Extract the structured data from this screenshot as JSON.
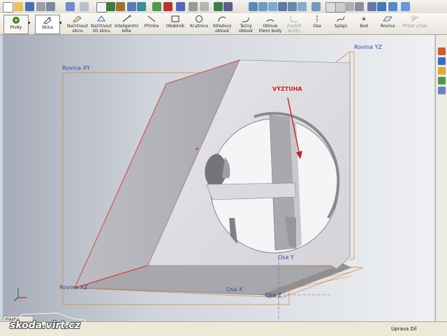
{
  "toolbar_top": {
    "icons": [
      "new-icon",
      "open-icon",
      "save-icon",
      "print-icon",
      "undo-icon",
      "redo-icon",
      "select-icon",
      "rebuild-icon",
      "options-icon",
      "zoom-fit-icon",
      "zoom-area-icon",
      "zoom-icon",
      "rotate-icon",
      "pan-icon",
      "view-orientation-icon",
      "display-style-icon",
      "section-view-icon",
      "appearance-icon",
      "scene-icon"
    ]
  },
  "command_manager": {
    "tabs": [
      {
        "label": "Prvky"
      },
      {
        "label": "Skica"
      }
    ],
    "commands": [
      {
        "label1": "Načrtnout",
        "label2": "skicu"
      },
      {
        "label1": "Načrtnout",
        "label2": "3D skicu"
      },
      {
        "label1": "Inteligentní",
        "label2": "kóta"
      },
      {
        "label1": "Přímka",
        "label2": ""
      },
      {
        "label1": "Obdélník",
        "label2": ""
      },
      {
        "label1": "Kružnice",
        "label2": ""
      },
      {
        "label1": "Středový",
        "label2": "oblouk"
      },
      {
        "label1": "Tečný",
        "label2": "oblouk"
      },
      {
        "label1": "Oblouk",
        "label2": "třemi body"
      },
      {
        "label1": "Zaoblit",
        "label2": "entity"
      },
      {
        "label1": "Osa",
        "label2": ""
      },
      {
        "label1": "Splajn",
        "label2": ""
      },
      {
        "label1": "Bod",
        "label2": ""
      },
      {
        "label1": "Rovina",
        "label2": ""
      },
      {
        "label1": "Přidat vztah",
        "label2": ""
      }
    ]
  },
  "viewport": {
    "plane_xy": "Rovina XY",
    "plane_yz": "Rovina YZ",
    "plane_xz": "Rovina XZ",
    "axis_x": "Osa X",
    "axis_y": "Osa Y",
    "axis_z": "Osa Z",
    "annotation": "VÝZTUHA",
    "colors": {
      "annotation": "#d0201c",
      "plane_outline": "#d58c3c",
      "edge_highlight": "#e03030"
    }
  },
  "panel_tab": "Vlastní",
  "status": {
    "text": "Úprava Díl"
  },
  "watermark": "skoda.virt.cz"
}
